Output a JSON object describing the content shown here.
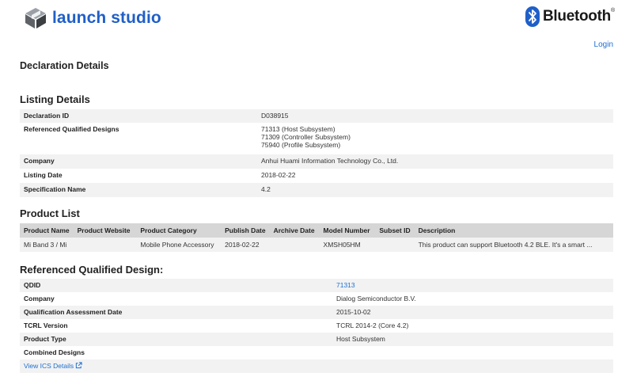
{
  "header": {
    "brand": "launch studio",
    "partner": "Bluetooth",
    "partner_mark": "®",
    "login_label": "Login"
  },
  "page_title": "Declaration Details",
  "listing": {
    "title": "Listing Details",
    "rows": [
      {
        "key": "Declaration ID",
        "values": [
          "D038915"
        ]
      },
      {
        "key": "Referenced Qualified Designs",
        "values": [
          "71313 (Host Subsystem)",
          "71309 (Controller Subsystem)",
          "75940 (Profile Subsystem)"
        ]
      },
      {
        "key": "Company",
        "values": [
          "Anhui Huami Information Technology Co., Ltd."
        ]
      },
      {
        "key": "Listing Date",
        "values": [
          "2018-02-22"
        ]
      },
      {
        "key": "Specification Name",
        "values": [
          "4.2"
        ]
      }
    ]
  },
  "product_list": {
    "title": "Product List",
    "columns": [
      "Product Name",
      "Product Website",
      "Product Category",
      "Publish Date",
      "Archive Date",
      "Model Number",
      "Subset ID",
      "Description"
    ],
    "rows": [
      [
        "Mi Band 3 / Mi",
        "",
        "Mobile Phone Accessory",
        "2018-02-22",
        "",
        "XMSH05HM",
        "",
        "This product can support Bluetooth 4.2 BLE. It's a smart ..."
      ]
    ]
  },
  "rqd": {
    "title": "Referenced Qualified Design:",
    "rows": [
      {
        "key": "QDID",
        "value": "71313"
      },
      {
        "key": "Company",
        "value": "Dialog Semiconductor B.V."
      },
      {
        "key": "Qualification Assessment Date",
        "value": "2015-10-02"
      },
      {
        "key": "TCRL Version",
        "value": "TCRL 2014-2 (Core 4.2)"
      },
      {
        "key": "Product Type",
        "value": "Host Subsystem"
      },
      {
        "key": "Combined Designs",
        "value": ""
      }
    ],
    "ics_link_label": "View ICS Details"
  },
  "colors": {
    "brand_blue": "#1f5fc8",
    "link_blue": "#1f6fd1",
    "row_alt": "#f2f2f2",
    "table_header": "#d6d6d6"
  },
  "icons": [
    "launch-studio-cube-icon",
    "bluetooth-rune-icon",
    "external-link-icon"
  ]
}
